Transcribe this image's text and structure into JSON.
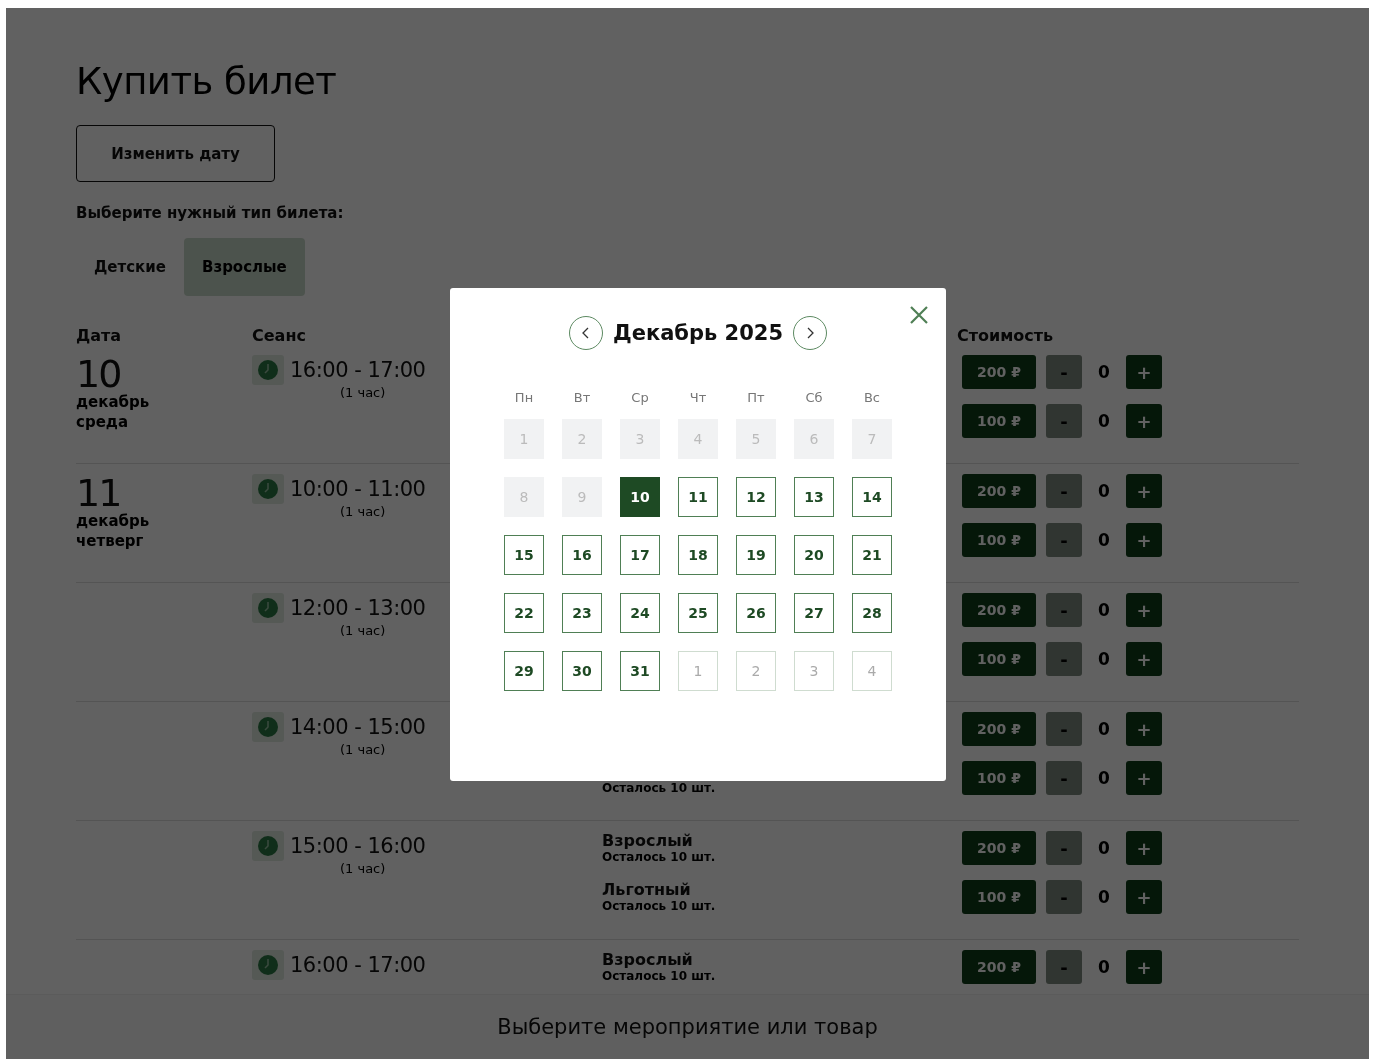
{
  "page": {
    "title": "Купить билет",
    "change_date_button": "Изменить дату",
    "ticket_type_prompt": "Выберите нужный тип билета:",
    "tabs": [
      {
        "label": "Детские",
        "selected": false
      },
      {
        "label": "Взрослые",
        "selected": true
      }
    ],
    "columns": {
      "date": "Дата",
      "session": "Сеанс",
      "cost": "Стоимость"
    },
    "dates": [
      {
        "day": "10",
        "month": "декабрь",
        "weekday": "среда",
        "sessions": [
          {
            "time": "16:00 - 17:00",
            "duration": "(1 час)",
            "tickets": [
              {
                "price": "200 ₽",
                "minus": "-",
                "count": "0",
                "plus": "+"
              },
              {
                "price": "100 ₽",
                "minus": "-",
                "count": "0",
                "plus": "+"
              }
            ]
          }
        ]
      },
      {
        "day": "11",
        "month": "декабрь",
        "weekday": "четверг",
        "sessions": [
          {
            "time": "10:00 - 11:00",
            "duration": "(1 час)",
            "tickets": [
              {
                "price": "200 ₽",
                "minus": "-",
                "count": "0",
                "plus": "+"
              },
              {
                "price": "100 ₽",
                "minus": "-",
                "count": "0",
                "plus": "+"
              }
            ]
          },
          {
            "time": "12:00 - 13:00",
            "duration": "(1 час)",
            "tickets": [
              {
                "price": "200 ₽",
                "minus": "-",
                "count": "0",
                "plus": "+"
              },
              {
                "price": "100 ₽",
                "minus": "-",
                "count": "0",
                "plus": "+"
              }
            ]
          },
          {
            "time": "14:00 - 15:00",
            "duration": "(1 час)",
            "tickets": [
              {
                "price": "200 ₽",
                "minus": "-",
                "count": "0",
                "plus": "+"
              },
              {
                "remaining": "Осталось 10 шт.",
                "price": "100 ₽",
                "minus": "-",
                "count": "0",
                "plus": "+"
              }
            ]
          },
          {
            "time": "15:00 - 16:00",
            "duration": "(1 час)",
            "tickets": [
              {
                "name": "Взрослый",
                "remaining": "Осталось 10 шт.",
                "price": "200 ₽",
                "minus": "-",
                "count": "0",
                "plus": "+"
              },
              {
                "name": "Льготный",
                "remaining": "Осталось 10 шт.",
                "price": "100 ₽",
                "minus": "-",
                "count": "0",
                "plus": "+"
              }
            ]
          },
          {
            "time": "16:00 - 17:00",
            "tickets": [
              {
                "name": "Взрослый",
                "remaining": "Осталось 10 шт.",
                "price": "200 ₽",
                "minus": "-",
                "count": "0",
                "plus": "+"
              }
            ]
          }
        ]
      }
    ],
    "footer": "Выберите мероприятие или товар"
  },
  "calendar": {
    "month": "Декабрь 2025",
    "weekdays": [
      "Пн",
      "Вт",
      "Ср",
      "Чт",
      "Пт",
      "Сб",
      "Вс"
    ],
    "days": [
      {
        "label": "1",
        "kind": "disabled",
        "selected": false
      },
      {
        "label": "2",
        "kind": "disabled",
        "selected": false
      },
      {
        "label": "3",
        "kind": "disabled",
        "selected": false
      },
      {
        "label": "4",
        "kind": "disabled",
        "selected": false
      },
      {
        "label": "5",
        "kind": "disabled",
        "selected": false
      },
      {
        "label": "6",
        "kind": "disabled",
        "selected": false
      },
      {
        "label": "7",
        "kind": "disabled",
        "selected": false
      },
      {
        "label": "8",
        "kind": "disabled",
        "selected": false
      },
      {
        "label": "9",
        "kind": "disabled",
        "selected": false
      },
      {
        "label": "10",
        "kind": "available",
        "selected": true
      },
      {
        "label": "11",
        "kind": "available",
        "selected": false
      },
      {
        "label": "12",
        "kind": "available",
        "selected": false
      },
      {
        "label": "13",
        "kind": "available",
        "selected": false
      },
      {
        "label": "14",
        "kind": "available",
        "selected": false
      },
      {
        "label": "15",
        "kind": "available",
        "selected": false
      },
      {
        "label": "16",
        "kind": "available",
        "selected": false
      },
      {
        "label": "17",
        "kind": "available",
        "selected": false
      },
      {
        "label": "18",
        "kind": "available",
        "selected": false
      },
      {
        "label": "19",
        "kind": "available",
        "selected": false
      },
      {
        "label": "20",
        "kind": "available",
        "selected": false
      },
      {
        "label": "21",
        "kind": "available",
        "selected": false
      },
      {
        "label": "22",
        "kind": "available",
        "selected": false
      },
      {
        "label": "23",
        "kind": "available",
        "selected": false
      },
      {
        "label": "24",
        "kind": "available",
        "selected": false
      },
      {
        "label": "25",
        "kind": "available",
        "selected": false
      },
      {
        "label": "26",
        "kind": "available",
        "selected": false
      },
      {
        "label": "27",
        "kind": "available",
        "selected": false
      },
      {
        "label": "28",
        "kind": "available",
        "selected": false
      },
      {
        "label": "29",
        "kind": "available",
        "selected": false
      },
      {
        "label": "30",
        "kind": "available",
        "selected": false
      },
      {
        "label": "31",
        "kind": "available",
        "selected": false
      },
      {
        "label": "1",
        "kind": "outside",
        "selected": false
      },
      {
        "label": "2",
        "kind": "outside",
        "selected": false
      },
      {
        "label": "3",
        "kind": "outside",
        "selected": false
      },
      {
        "label": "4",
        "kind": "outside",
        "selected": false
      }
    ]
  }
}
